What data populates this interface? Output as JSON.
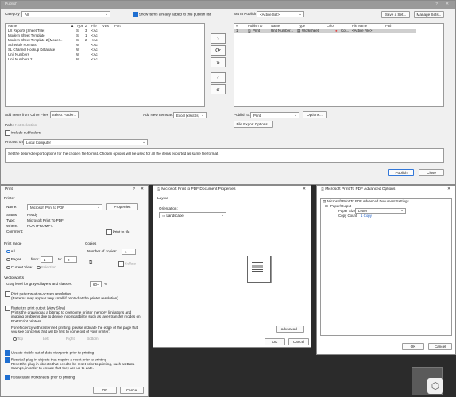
{
  "publish": {
    "title": "Publish",
    "window_controls": {
      "help": "?",
      "close": "✕"
    },
    "category_label": "Category",
    "category_value": "All",
    "show_views_label": "Show items already added to this publish list",
    "columns": [
      "Name",
      "Type",
      "Z",
      "File",
      "Vws",
      "Port"
    ],
    "sort_indicator": "▲",
    "items": [
      {
        "name": "LX Reports [Sheet Title]",
        "type": "S",
        "z": "3",
        "file": "<Ac"
      },
      {
        "name": "Modern Sheet Template",
        "type": "S",
        "z": "1",
        "file": "<Ac"
      },
      {
        "name": "Modern Sheet Template 2 [Moder...",
        "type": "S",
        "z": "2",
        "file": "<Ac"
      },
      {
        "name": "Schedule Formats",
        "type": "W",
        "z": "",
        "file": "<Ac"
      },
      {
        "name": "SL Channel Hookup Database",
        "type": "W",
        "z": "",
        "file": "<Ac"
      },
      {
        "name": "Unit Numbers",
        "type": "W",
        "z": "",
        "file": "<Ac"
      },
      {
        "name": "Unit Numbers 2",
        "type": "W",
        "z": "",
        "file": "<Ac"
      }
    ],
    "set_to_publish_label": "Set to Publish",
    "set_to_publish_value": "<Active Set>",
    "save_set": "Save a Set...",
    "manage_sets": "Manage Sets...",
    "right_columns": [
      "#",
      "Publish to",
      "Name",
      "Type",
      "Color",
      "File Name",
      "Path"
    ],
    "right_rows": [
      {
        "num": "1",
        "publish_to": "Print",
        "name": "Unit Number...",
        "type": "Worksheet",
        "color": "Col...",
        "file": "<Active File>",
        "path": ""
      }
    ],
    "add_other_files": "Add Items from Other Files",
    "select_folder": "Select Folder...",
    "add_new_items_as": "Add New Items as:",
    "add_new_items_value": "Excel (xlsx/xls)",
    "publish_to_label": "Publish to:",
    "publish_to_value": "Print",
    "options_btn": "Options...",
    "file_export_options": "File Export Options...",
    "path_label": "Path:",
    "path_value": "Not Selection",
    "include_subfolders": "Include subfolders",
    "process_on_label": "Process on:",
    "process_on_value": "Local Computer",
    "info_text": "Set the desired export options for the chosen file format. Chosen options will be used for all the items exported as same file format.",
    "publish_btn": "Publish",
    "close_btn": "Close"
  },
  "print": {
    "title": "Print",
    "help": "?",
    "close": "✕",
    "printer_section": "Printer",
    "name_label": "Name:",
    "name_value": "Microsoft Print to PDF",
    "properties_btn": "Properties",
    "status_label": "Status:",
    "status_value": "Ready",
    "type_label": "Type:",
    "type_value": "Microsoft Print To PDF",
    "where_label": "Where:",
    "where_value": "PORTPROMPT:",
    "comment_label": "Comment:",
    "print_to_file": "Print to file",
    "print_range": "Print range",
    "all": "All",
    "pages": "Pages",
    "from": "from:",
    "from_value": "1",
    "to": "to:",
    "to_value": "2",
    "current_view": "Current View",
    "selection": "Selection",
    "copies_section": "Copies",
    "num_copies": "Number of copies:",
    "num_copies_value": "1",
    "collate": "Collate",
    "vectorworks_section": "Vectorworks",
    "gray_level": "Gray level for grayed layers and classes:",
    "gray_value": "60",
    "gray_unit": "%",
    "print_patterns": "Print patterns at on-screen resolution",
    "print_patterns_note": "(Patterns may appear very small if printed at the printer resolution)",
    "rasterize": "Rasterize print output  (Very Slow)",
    "rasterize_note": "Prints the drawing as a bitmap to overcome printer memory limitations and imaging problems due to device incompatibility, such as layer transfer modes on PostScript printers.",
    "efficiency_note": "For efficiency with rasterized printing, please indicate the edge of the page that you see concerns that will be first to come out of your printer:",
    "edges": [
      "Top",
      "Left",
      "Right",
      "Bottom"
    ],
    "update_viewports": "Update visible out of date viewports prior to printing",
    "reset_plugins": "Reset all plug-in objects that require a reset prior to printing",
    "reset_plugins_note": "Reset the plug-in objects that need to be reset prior to printing, such as Data Stamps, in order to ensure that they are up to date.",
    "recalc_worksheets": "Recalculate worksheets prior to printing",
    "ok": "OK",
    "cancel": "Cancel"
  },
  "pdf_props": {
    "title": "Microsoft Print to PDF Document Properties",
    "close": "✕",
    "tab": "Layout",
    "orientation_label": "Orientation:",
    "orientation_value": "Landscape",
    "advanced_btn": "Advanced...",
    "ok": "OK",
    "cancel": "Cancel"
  },
  "pdf_adv": {
    "title": "Microsoft Print To PDF Advanced Options",
    "close": "✕",
    "root": "Microsoft Print To PDF Advanced Document Settings",
    "paper_output": "Paper/Output",
    "paper_size_label": "Paper Size:",
    "paper_size_value": "Letter",
    "copy_count_label": "Copy Count:",
    "copy_count_value": "1 Copy",
    "ok": "OK",
    "cancel": "Cancel"
  },
  "colors": {
    "accent": "#1f6fd1",
    "publish_titlebar": "#9a9a9a",
    "dark_bg": "#2b2b2b"
  }
}
